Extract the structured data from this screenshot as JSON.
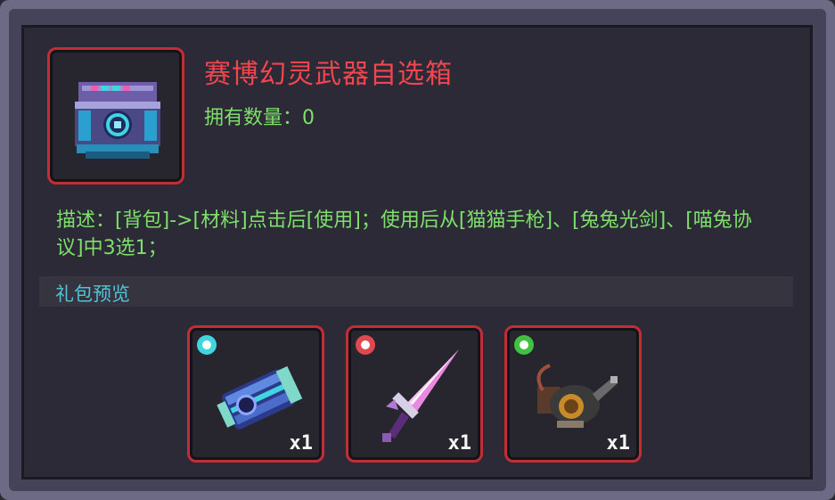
{
  "item": {
    "title": "赛博幻灵武器自选箱",
    "count_label": "拥有数量：0",
    "icon": "cyber-chest-icon"
  },
  "description": "描述：[背包]->[材料]点击后[使用]；使用后从[猫猫手枪]、[兔兔光剑]、[喵兔协议]中3选1；",
  "preview": {
    "label": "礼包预览",
    "items": [
      {
        "icon": "cyber-gauntlet-icon",
        "quantity": "x1",
        "rarity_color": "#3fd6e0"
      },
      {
        "icon": "bunny-lightsaber-icon",
        "quantity": "x1",
        "rarity_color": "#e24850"
      },
      {
        "icon": "meow-bunny-device-icon",
        "quantity": "x1",
        "rarity_color": "#3fc23f"
      }
    ]
  },
  "colors": {
    "title": "#f2464e",
    "text": "#7ee06a",
    "section": "#52c4d9",
    "border": "#c22d36"
  }
}
